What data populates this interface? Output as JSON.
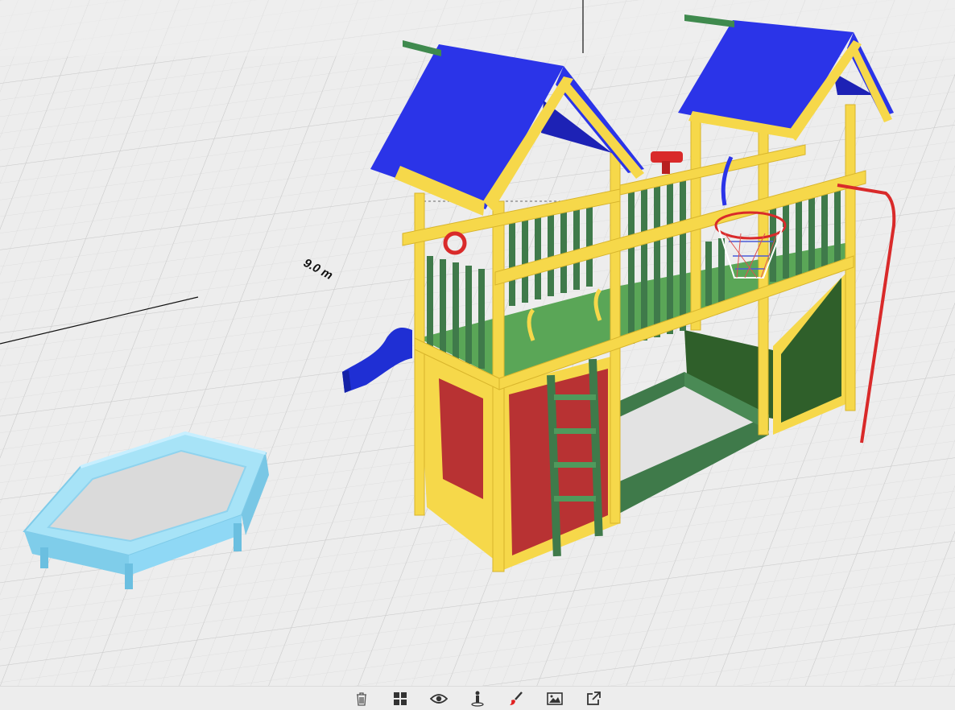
{
  "viewport": {
    "dimension_label": "9.0 m",
    "objects": [
      "playground-tower",
      "sandbox"
    ],
    "colors": {
      "roof": "#2b34e8",
      "frame": "#f6d84a",
      "railing": "#3f7a4a",
      "floor": "#5aa657",
      "wall_red": "#b83233",
      "wall_green": "#2f5f2a",
      "slide": "#1f2fd4",
      "sandbox": "#8fd8f5",
      "accent_red": "#d92a2a"
    }
  },
  "toolbar": {
    "buttons": [
      {
        "icon": "trash-icon",
        "action": "delete"
      },
      {
        "icon": "grid-icon",
        "action": "catalog"
      },
      {
        "icon": "eye-icon",
        "action": "view"
      },
      {
        "icon": "person-icon",
        "action": "human-scale"
      },
      {
        "icon": "paint-brush-icon",
        "action": "colors"
      },
      {
        "icon": "image-icon",
        "action": "background"
      },
      {
        "icon": "share-icon",
        "action": "export"
      }
    ]
  }
}
